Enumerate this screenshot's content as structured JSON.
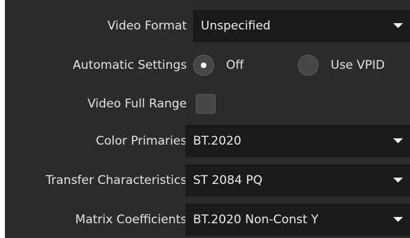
{
  "video_format": {
    "label": "Video Format",
    "value": "Unspecified"
  },
  "automatic_settings": {
    "label": "Automatic Settings",
    "selected": "Off",
    "options": [
      "Off",
      "Use VPID"
    ]
  },
  "video_full_range": {
    "label": "Video Full Range",
    "checked": false
  },
  "color_primaries": {
    "label": "Color Primaries",
    "value": "BT.2020"
  },
  "transfer_characteristics": {
    "label": "Transfer Characteristics",
    "value": "ST 2084 PQ"
  },
  "matrix_coefficients": {
    "label": "Matrix Coefficients",
    "value": "BT.2020 Non-Const Y"
  },
  "colors": {
    "panel_bg": "#2b2b2b",
    "field_bg": "#1a1a1a",
    "text": "#e3e3e3",
    "control_bg": "#474747"
  },
  "icons": {
    "dropdown": "chevron-down-icon",
    "radio_selected": "radio-selected-icon",
    "radio_unselected": "radio-unselected-icon"
  }
}
